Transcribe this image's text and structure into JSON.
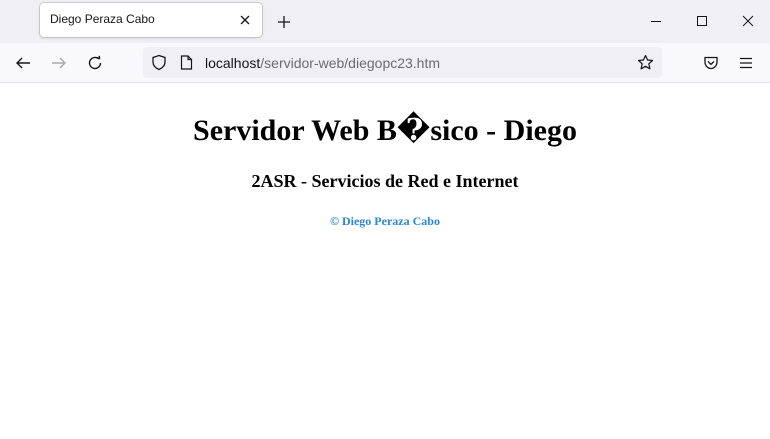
{
  "browser": {
    "tab": {
      "title": "Diego Peraza Cabo"
    },
    "url": {
      "host": "localhost",
      "path": "/servidor-web/diegopc23.htm"
    }
  },
  "page": {
    "heading": "Servidor Web B�sico - Diego",
    "subheading": "2ASR - Servicios de Red e Internet",
    "footer": "© Diego Peraza Cabo",
    "colors": {
      "footer": "#2a86d6",
      "background": "#ffffff"
    }
  }
}
